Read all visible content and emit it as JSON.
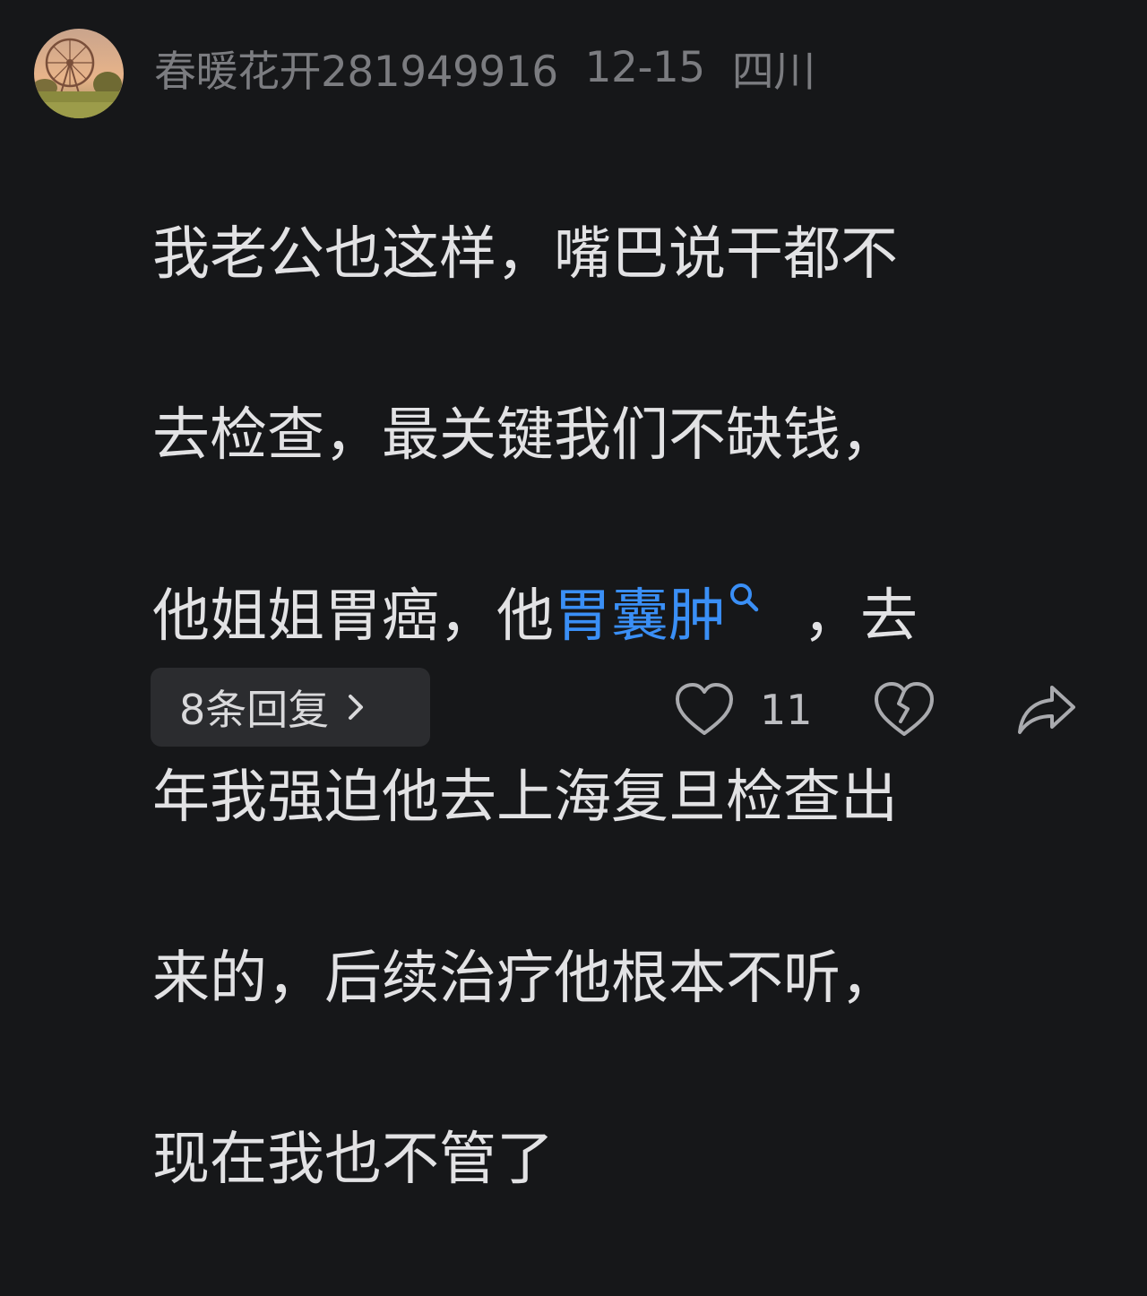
{
  "comment": {
    "username": "春暖花开281949916",
    "date": "12-15",
    "location": "四川",
    "lines": [
      "我老公也这样，嘴巴说干都不",
      "去检查，最关键我们不缺钱，",
      "他姐姐胃癌，他",
      "年我强迫他去上海复旦检查出",
      "来的，后续治疗他根本不听，",
      "现在我也不管了"
    ],
    "highlight_link": "胃囊肿",
    "line3_tail": "，去",
    "replies_label": "8条回复",
    "like_count": "11"
  },
  "colors": {
    "background": "#161719",
    "link": "#3a8ff6",
    "meta_text": "#7b7c80",
    "button_bg": "#2b2c2f"
  },
  "icons": {
    "search": "search-icon",
    "chevron": "chevron-right-icon",
    "like": "heart-icon",
    "dislike": "broken-heart-icon",
    "share": "share-arrow-icon"
  }
}
